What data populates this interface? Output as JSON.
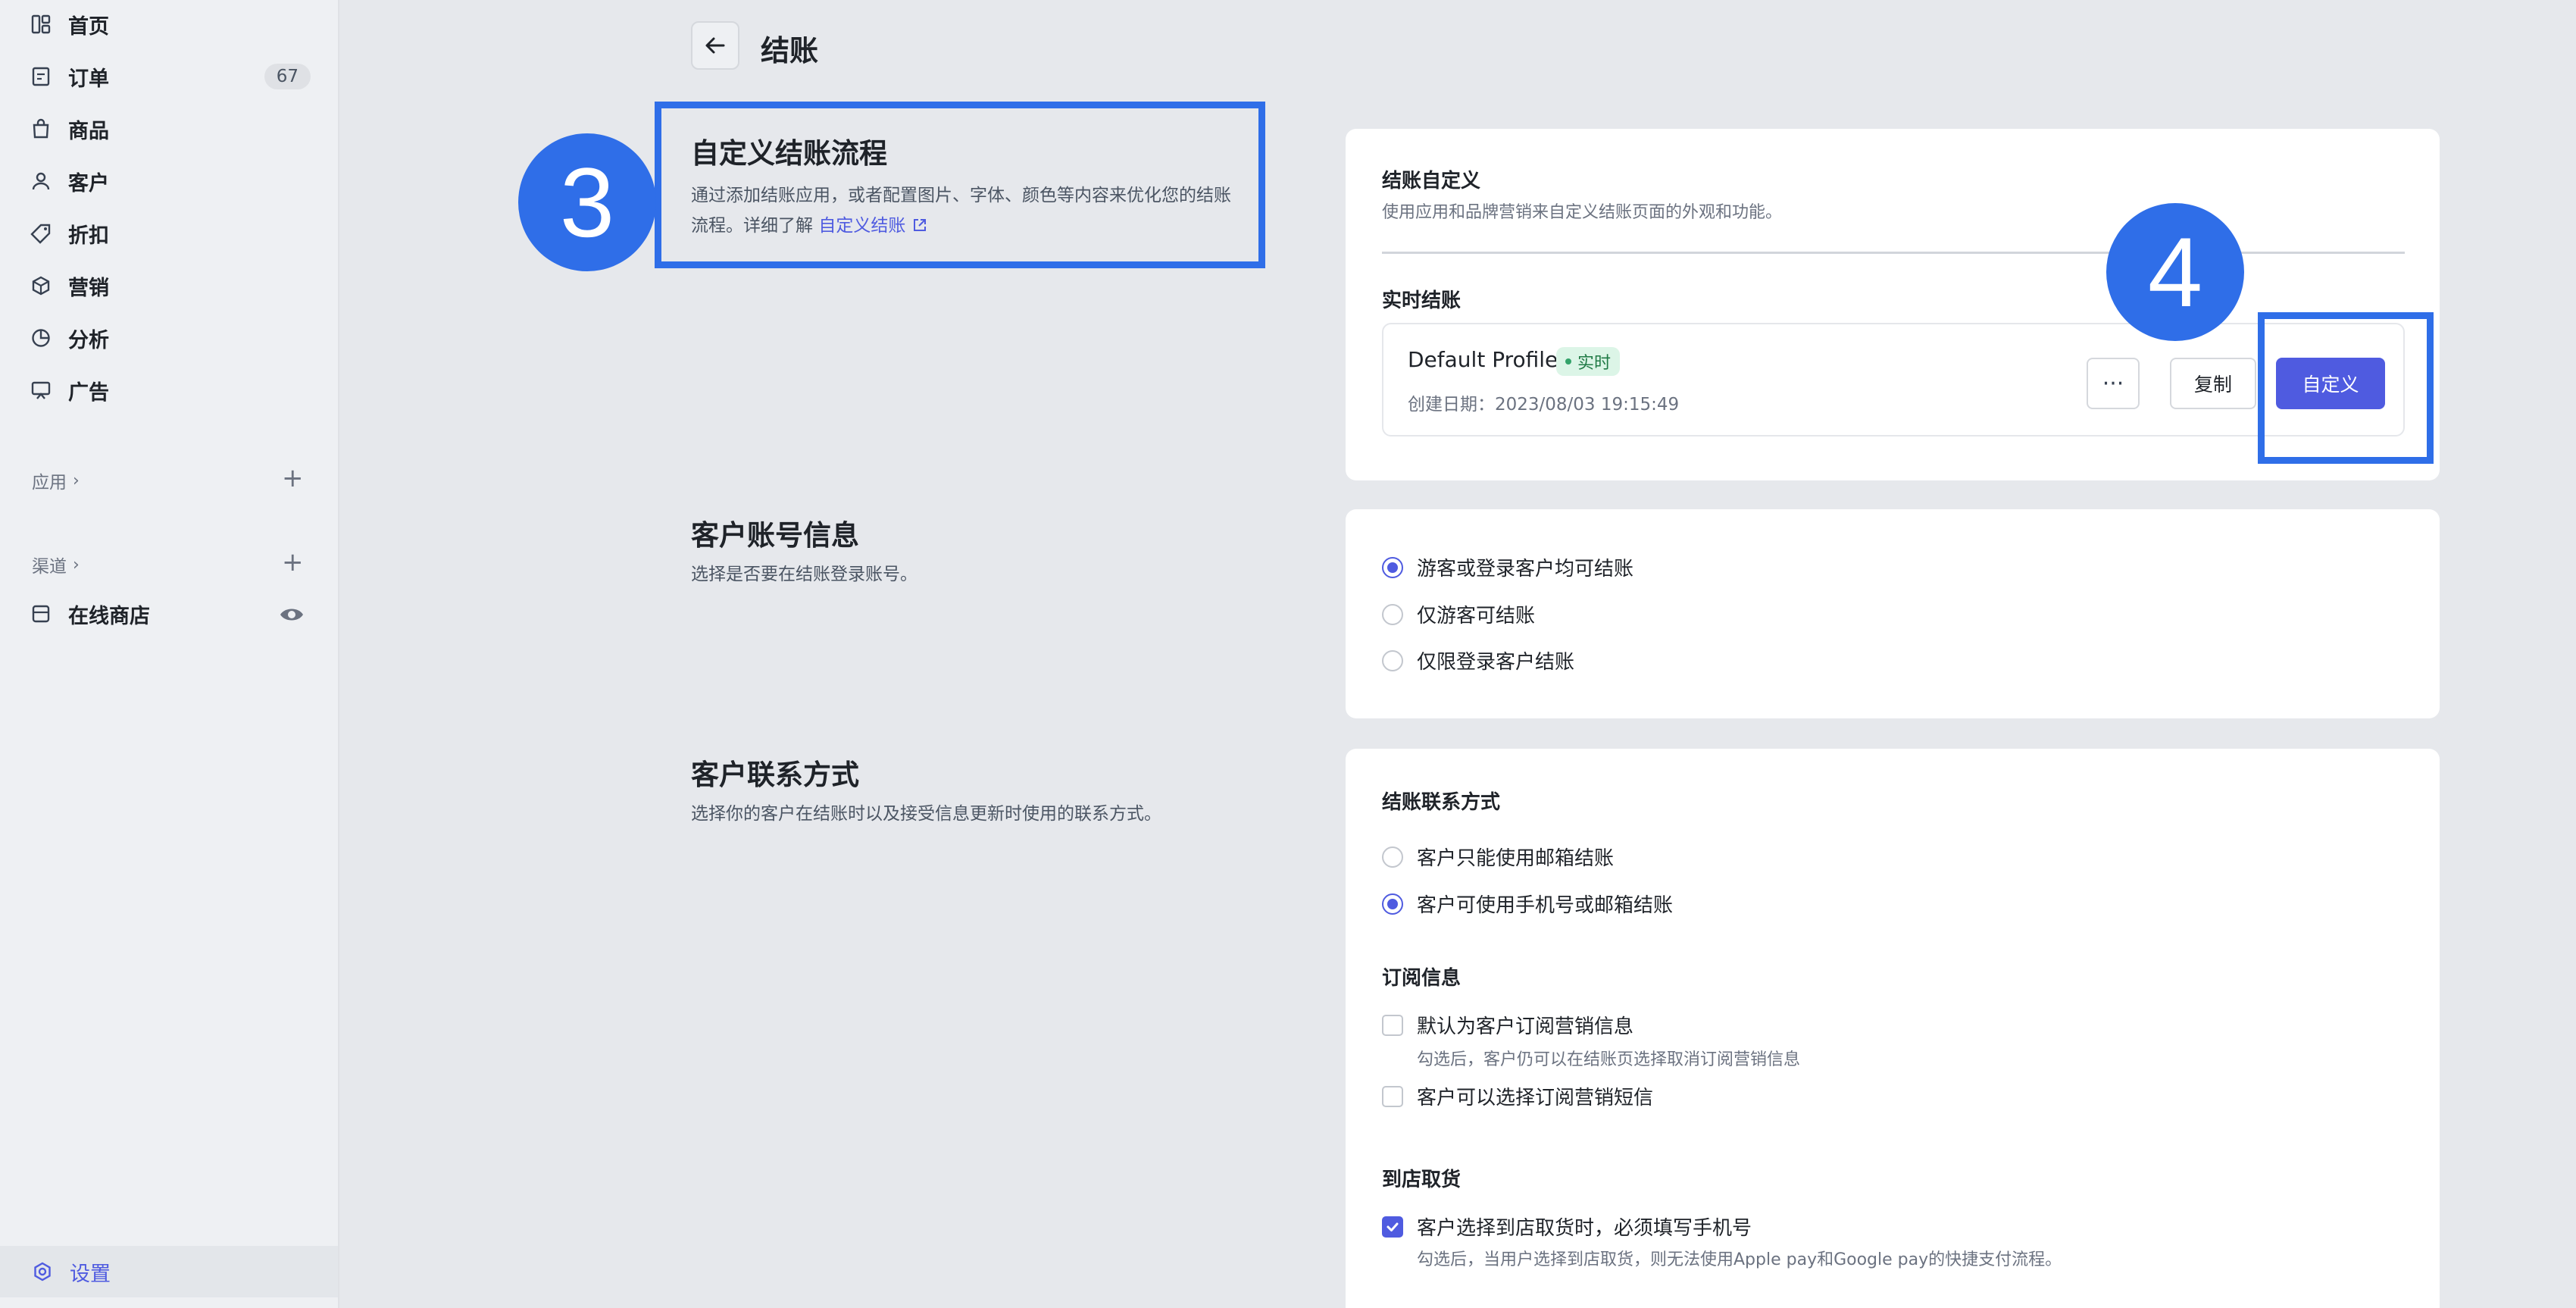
{
  "sidebar": {
    "items": [
      {
        "label": "首页",
        "icon": "dashboard-icon"
      },
      {
        "label": "订单",
        "icon": "order-icon",
        "badge": "67"
      },
      {
        "label": "商品",
        "icon": "bag-icon"
      },
      {
        "label": "客户",
        "icon": "user-icon"
      },
      {
        "label": "折扣",
        "icon": "tag-icon"
      },
      {
        "label": "营销",
        "icon": "cube-icon"
      },
      {
        "label": "分析",
        "icon": "pie-chart-icon"
      },
      {
        "label": "广告",
        "icon": "ad-icon"
      }
    ],
    "apps_label": "应用",
    "channels_label": "渠道",
    "online_store_label": "在线商店",
    "settings_label": "设置"
  },
  "header": {
    "title": "结账"
  },
  "custom_flow": {
    "title": "自定义结账流程",
    "desc_line1": "通过添加结账应用，或者配置图片、字体、颜色等内容来优化您的结账",
    "desc_line2_prefix": "流程。详细了解",
    "link_text": "自定义结账"
  },
  "checkout_custom_card": {
    "title": "结账自定义",
    "subtitle": "使用应用和品牌营销来自定义结账页面的外观和功能。",
    "live_section_title": "实时结账",
    "profile_name": "Default Profile",
    "live_badge": "实时",
    "created": "创建日期：2023/08/03 19:15:49",
    "more_label": "···",
    "copy_label": "复制",
    "customize_label": "自定义"
  },
  "account_info": {
    "title": "客户账号信息",
    "desc": "选择是否要在结账登录账号。",
    "options": [
      {
        "label": "游客或登录客户均可结账",
        "selected": true
      },
      {
        "label": "仅游客可结账",
        "selected": false
      },
      {
        "label": "仅限登录客户结账",
        "selected": false
      }
    ]
  },
  "contact": {
    "title": "客户联系方式",
    "desc": "选择你的客户在结账时以及接受信息更新时使用的联系方式。",
    "checkout_contact_title": "结账联系方式",
    "contact_options": [
      {
        "label": "客户只能使用邮箱结账",
        "selected": false
      },
      {
        "label": "客户可使用手机号或邮箱结账",
        "selected": true
      }
    ],
    "subscription_title": "订阅信息",
    "sub_option1": "默认为客户订阅营销信息",
    "sub_option1_hint": "勾选后，客户仍可以在结账页选择取消订阅营销信息",
    "sub_option2": "客户可以选择订阅营销短信",
    "pickup_title": "到店取货",
    "pickup_option": "客户选择到店取货时，必须填写手机号",
    "pickup_hint": "勾选后，当用户选择到店取货，则无法使用Apple pay和Google pay的快捷支付流程。"
  },
  "annotations": {
    "step3": "3",
    "step4": "4",
    "color": "#2f6ee8"
  }
}
